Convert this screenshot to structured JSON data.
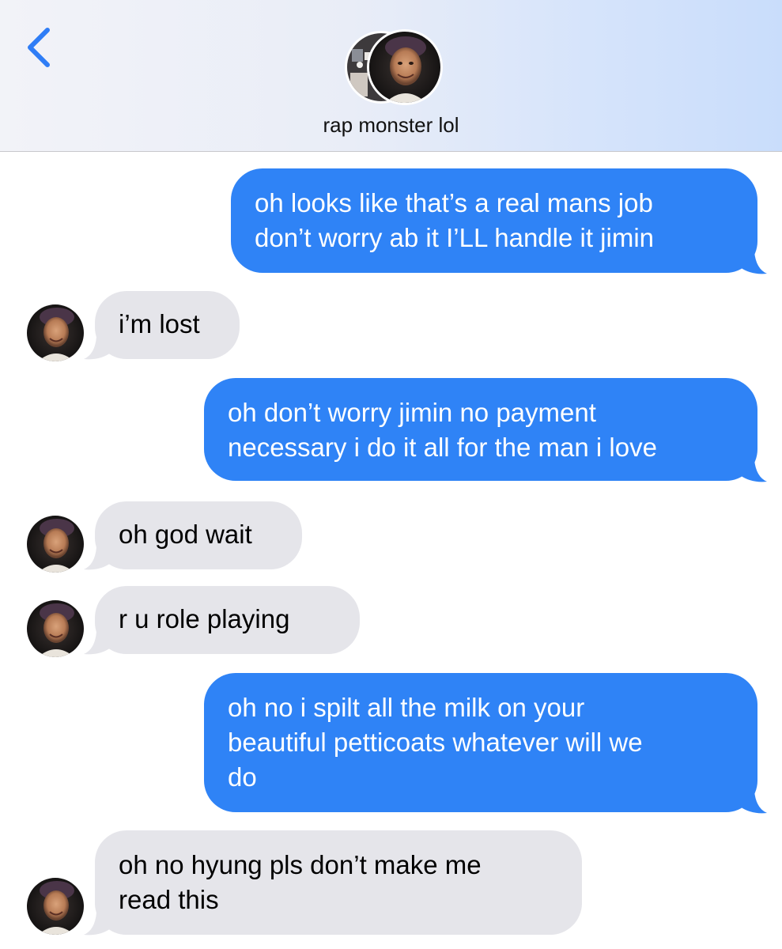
{
  "header": {
    "contact_name": "rap monster lol"
  },
  "messages": [
    {
      "direction": "outgoing",
      "text": "oh looks like that’s a real mans job\ndon’t worry ab it I’LL handle it jimin"
    },
    {
      "direction": "incoming",
      "text": "i’m lost"
    },
    {
      "direction": "outgoing",
      "text": "oh don’t worry jimin no payment\nnecessary i do it all for the man i love"
    },
    {
      "direction": "incoming",
      "text": "oh god wait"
    },
    {
      "direction": "incoming",
      "text": "r u role playing"
    },
    {
      "direction": "outgoing",
      "text": "oh no i spilt all the milk on your\nbeautiful petticoats whatever will we\ndo"
    },
    {
      "direction": "incoming",
      "text": "oh no hyung pls don’t make me\nread this"
    }
  ],
  "colors": {
    "outgoing_bubble": "#2f83f6",
    "incoming_bubble": "#e5e5ea",
    "accent": "#2f7df6"
  },
  "icons": {
    "back": "chevron-left-icon",
    "avatar": "contact-photo"
  }
}
